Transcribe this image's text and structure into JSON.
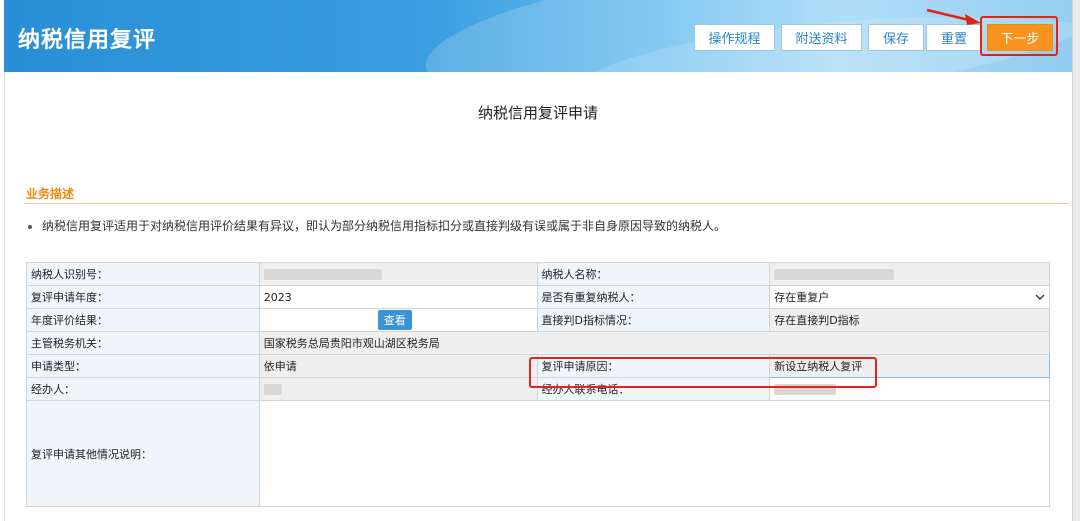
{
  "header": {
    "title": "纳税信用复评",
    "buttons": {
      "operation": "操作规程",
      "attachment": "附送资料",
      "save": "保存",
      "reset": "重置",
      "next": "下一步"
    }
  },
  "page": {
    "title": "纳税信用复评申请",
    "section_title": "业务描述",
    "description": "纳税信用复评适用于对纳税信用评价结果有异议，即认为部分纳税信用指标扣分或直接判级有误或属于非自身原因导致的纳税人。"
  },
  "form": {
    "taxpayer_id_label": "纳税人识别号：",
    "taxpayer_name_label": "纳税人名称：",
    "review_year_label": "复评申请年度：",
    "review_year_value": "2023",
    "repeat_taxpayer_label": "是否有重复纳税人：",
    "repeat_taxpayer_value": "存在重复户",
    "annual_result_label": "年度评价结果：",
    "view_button": "查看",
    "direct_d_label": "直接判D指标情况：",
    "direct_d_value": "存在直接判D指标",
    "tax_authority_label": "主管税务机关：",
    "tax_authority_value": "国家税务总局贵阳市观山湖区税务局",
    "apply_type_label": "申请类型：",
    "apply_type_value": "依申请",
    "review_reason_label": "复评申请原因：",
    "review_reason_value": "新设立纳税人复评",
    "handler_label": "经办人：",
    "handler_phone_label": "经办人联系电话：",
    "other_notes_label": "复评申请其他情况说明："
  },
  "colors": {
    "accent_orange": "#f7931e",
    "header_blue": "#2a8ed6",
    "highlight_red": "#e2231a"
  },
  "icons": {
    "dropdown": "chevron-down-icon",
    "arrow": "red-arrow-icon"
  }
}
